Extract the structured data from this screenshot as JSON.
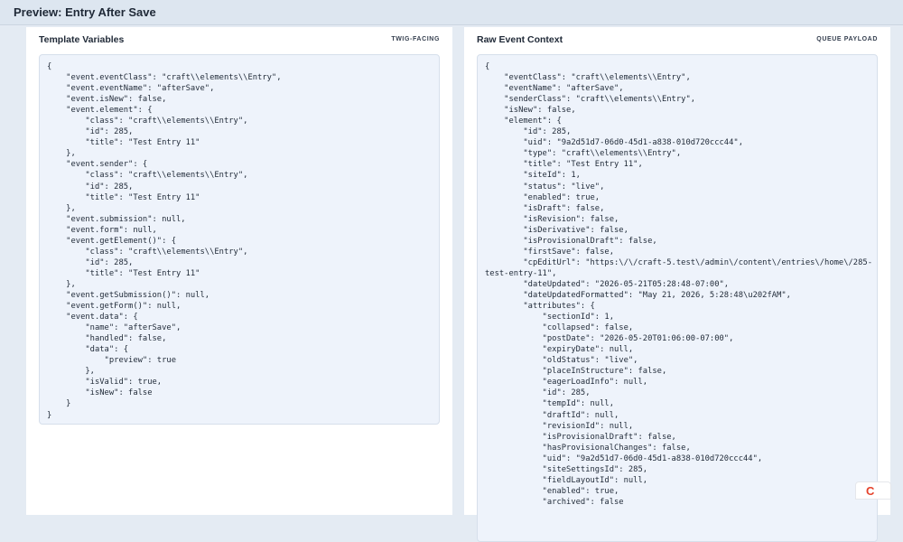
{
  "window": {
    "title": "Preview: Entry After Save"
  },
  "template_panel": {
    "title": "Template Variables",
    "tag": "TWIG-FACING",
    "code": "{\n    \"event.eventClass\": \"craft\\\\elements\\\\Entry\",\n    \"event.eventName\": \"afterSave\",\n    \"event.isNew\": false,\n    \"event.element\": {\n        \"class\": \"craft\\\\elements\\\\Entry\",\n        \"id\": 285,\n        \"title\": \"Test Entry 11\"\n    },\n    \"event.sender\": {\n        \"class\": \"craft\\\\elements\\\\Entry\",\n        \"id\": 285,\n        \"title\": \"Test Entry 11\"\n    },\n    \"event.submission\": null,\n    \"event.form\": null,\n    \"event.getElement()\": {\n        \"class\": \"craft\\\\elements\\\\Entry\",\n        \"id\": 285,\n        \"title\": \"Test Entry 11\"\n    },\n    \"event.getSubmission()\": null,\n    \"event.getForm()\": null,\n    \"event.data\": {\n        \"name\": \"afterSave\",\n        \"handled\": false,\n        \"data\": {\n            \"preview\": true\n        },\n        \"isValid\": true,\n        \"isNew\": false\n    }\n}"
  },
  "raw_panel": {
    "title": "Raw Event Context",
    "tag": "QUEUE PAYLOAD",
    "code": "{\n    \"eventClass\": \"craft\\\\elements\\\\Entry\",\n    \"eventName\": \"afterSave\",\n    \"senderClass\": \"craft\\\\elements\\\\Entry\",\n    \"isNew\": false,\n    \"element\": {\n        \"id\": 285,\n        \"uid\": \"9a2d51d7-06d0-45d1-a838-010d720ccc44\",\n        \"type\": \"craft\\\\elements\\\\Entry\",\n        \"title\": \"Test Entry 11\",\n        \"siteId\": 1,\n        \"status\": \"live\",\n        \"enabled\": true,\n        \"isDraft\": false,\n        \"isRevision\": false,\n        \"isDerivative\": false,\n        \"isProvisionalDraft\": false,\n        \"firstSave\": false,\n        \"cpEditUrl\": \"https:\\/\\/craft-5.test\\/admin\\/content\\/entries\\/home\\/285-\ntest-entry-11\",\n        \"dateUpdated\": \"2026-05-21T05:28:48-07:00\",\n        \"dateUpdatedFormatted\": \"May 21, 2026, 5:28:48\\u202fAM\",\n        \"attributes\": {\n            \"sectionId\": 1,\n            \"collapsed\": false,\n            \"postDate\": \"2026-05-20T01:06:00-07:00\",\n            \"expiryDate\": null,\n            \"oldStatus\": \"live\",\n            \"placeInStructure\": false,\n            \"eagerLoadInfo\": null,\n            \"id\": 285,\n            \"tempId\": null,\n            \"draftId\": null,\n            \"revisionId\": null,\n            \"isProvisionalDraft\": false,\n            \"hasProvisionalChanges\": false,\n            \"uid\": \"9a2d51d7-06d0-45d1-a838-010d720ccc44\",\n            \"siteSettingsId\": 285,\n            \"fieldLayoutId\": null,\n            \"enabled\": true,\n            \"archived\": false"
  },
  "badge": {
    "label": "C",
    "color": "#e5422b"
  }
}
